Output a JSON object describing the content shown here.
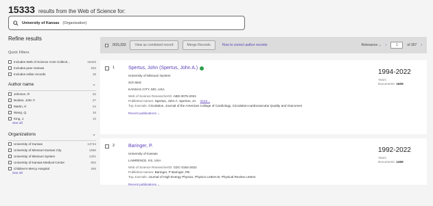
{
  "header": {
    "count": "15333",
    "subtitle": "results from the Web of Science for:"
  },
  "search": {
    "query_bold": "University of Kansas",
    "query_tag": "(Organization)"
  },
  "sidebar": {
    "title": "Refine results",
    "quick_filters_label": "Quick Filters",
    "quick_filters": [
      {
        "label": "Includes Web of Science Core Collecti...",
        "count": "15333"
      },
      {
        "label": "Includes peer reviews",
        "count": "253"
      },
      {
        "label": "Includes editor records",
        "count": "18"
      }
    ],
    "author_section": "Author name",
    "authors": [
      {
        "label": "Johnson, R",
        "count": "32"
      },
      {
        "label": "Booker, John T.",
        "count": "27"
      },
      {
        "label": "Martin, K",
        "count": "24"
      },
      {
        "label": "Wang, Q.",
        "count": "16"
      },
      {
        "label": "King, J.",
        "count": "13"
      }
    ],
    "see_all": "See all",
    "org_section": "Organizations",
    "orgs": [
      {
        "label": "University of Kansas",
        "count": "13744"
      },
      {
        "label": "University of Missouri Kansas City",
        "count": "1556"
      },
      {
        "label": "University of Missouri System",
        "count": "1201"
      },
      {
        "label": "University of Kansas Medical Center",
        "count": "802"
      },
      {
        "label": "Children's Mercy Hospital",
        "count": "265"
      }
    ]
  },
  "toolbar": {
    "selected": "0/15,333",
    "view_combined": "View as combined record",
    "merge": "Merge Records",
    "correct_link": "How to correct author records",
    "sort": "Relevance",
    "page": "1",
    "of_pages": "of 307"
  },
  "results": [
    {
      "index": "1",
      "name": "Spertus, John (Spertus, John A.)",
      "org": "University of Missouri System",
      "dept": "Sch Med",
      "location": "KANSAS CITY, MO, USA",
      "researcher_id_label": "Web of Science ResearcherID:",
      "researcher_id": "ABD-3075-2021",
      "published_label": "Published names:",
      "published": "Spertus, John A.   Spertus, JA",
      "more": "more...",
      "journals_label": "Top Journals:",
      "journals": "Circulation, Journal of the American College of Cardiology, Circulation-cardiovascular Quality and Outcomes",
      "recent": "Recent publications",
      "years": "1994-2022",
      "years_label": "Years",
      "docs_label": "Documents:",
      "docs": "1609"
    },
    {
      "index": "2",
      "name": "Baringer, P.",
      "org": "University of Kansas",
      "location": "LAWRENCE, KS, USA",
      "researcher_id_label": "Web of Science ResearcherID:",
      "researcher_id": "CDC-3154-2022",
      "published_label": "Published names:",
      "published": "Baringer, P   Baringer, PB",
      "journals_label": "Top Journals:",
      "journals": "Journal of High Energy Physics, Physics Letters B, Physical Review Letters",
      "recent": "Recent publications",
      "years": "1992-2022",
      "years_label": "Years",
      "docs_label": "Documents:",
      "docs": "1469"
    }
  ]
}
